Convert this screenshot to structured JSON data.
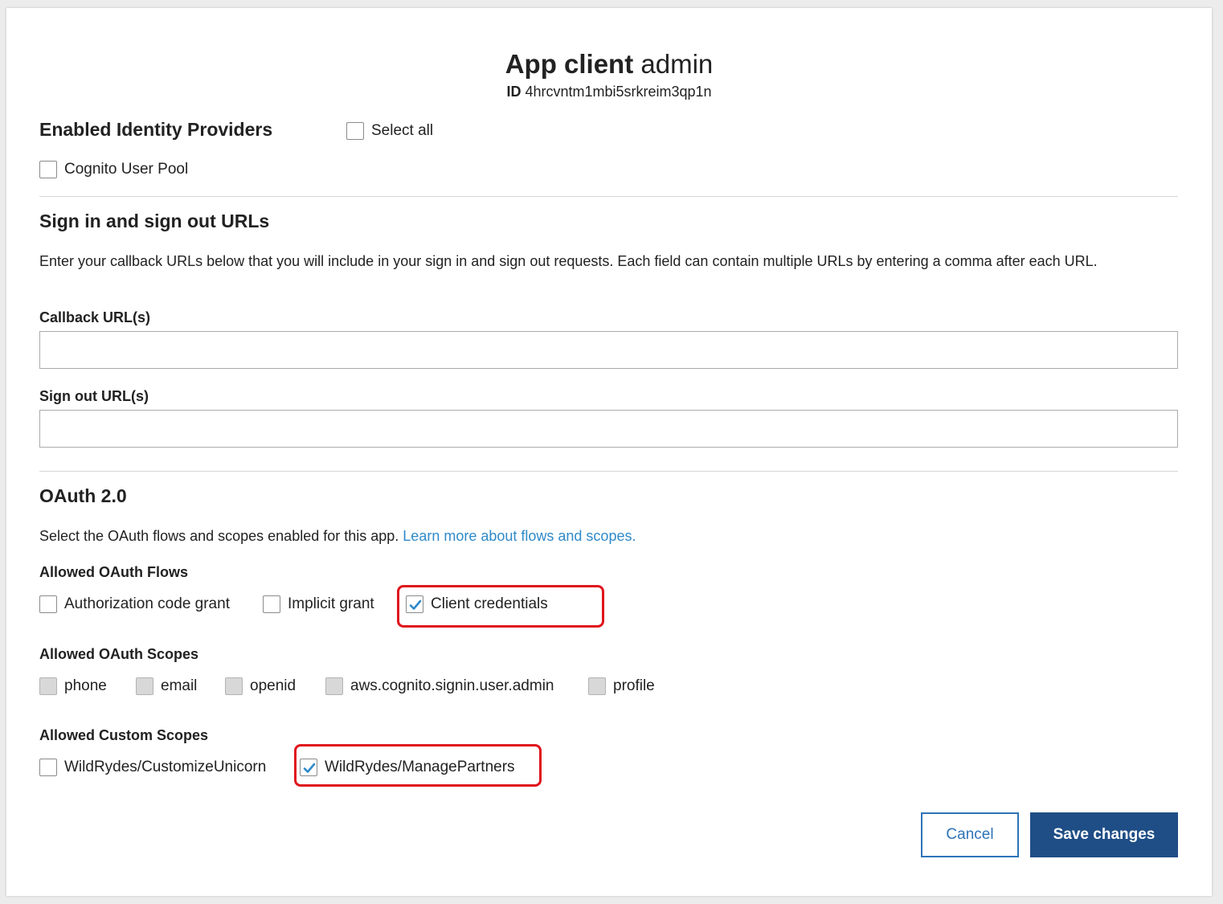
{
  "header": {
    "title_strong": "App client",
    "title_name": "admin",
    "id_label": "ID",
    "id_value": "4hrcvntm1mbi5srkreim3qp1n"
  },
  "identity_providers": {
    "title": "Enabled Identity Providers",
    "select_all_label": "Select all",
    "select_all_checked": false,
    "providers": [
      {
        "label": "Cognito User Pool",
        "checked": false
      }
    ]
  },
  "urls": {
    "title": "Sign in and sign out URLs",
    "description": "Enter your callback URLs below that you will include in your sign in and sign out requests. Each field can contain multiple URLs by entering a comma after each URL.",
    "callback_label": "Callback URL(s)",
    "callback_value": "",
    "signout_label": "Sign out URL(s)",
    "signout_value": ""
  },
  "oauth": {
    "title": "OAuth 2.0",
    "description": "Select the OAuth flows and scopes enabled for this app.",
    "learn_more_link": "Learn more about flows and scopes.",
    "flows_label": "Allowed OAuth Flows",
    "flows": [
      {
        "label": "Authorization code grant",
        "checked": false
      },
      {
        "label": "Implicit grant",
        "checked": false
      },
      {
        "label": "Client credentials",
        "checked": true
      }
    ],
    "scopes_label": "Allowed OAuth Scopes",
    "scopes": [
      {
        "label": "phone",
        "checked": false,
        "disabled": true
      },
      {
        "label": "email",
        "checked": false,
        "disabled": true
      },
      {
        "label": "openid",
        "checked": false,
        "disabled": true
      },
      {
        "label": "aws.cognito.signin.user.admin",
        "checked": false,
        "disabled": true
      },
      {
        "label": "profile",
        "checked": false,
        "disabled": true
      }
    ],
    "custom_scopes_label": "Allowed Custom Scopes",
    "custom_scopes": [
      {
        "label": "WildRydes/CustomizeUnicorn",
        "checked": false
      },
      {
        "label": "WildRydes/ManagePartners",
        "checked": true
      }
    ]
  },
  "actions": {
    "cancel_label": "Cancel",
    "save_label": "Save changes"
  },
  "colors": {
    "highlight": "#e0141c",
    "link": "#2f8ac9",
    "primary": "#1f4e86",
    "checkmark": "#2f8ac9"
  }
}
